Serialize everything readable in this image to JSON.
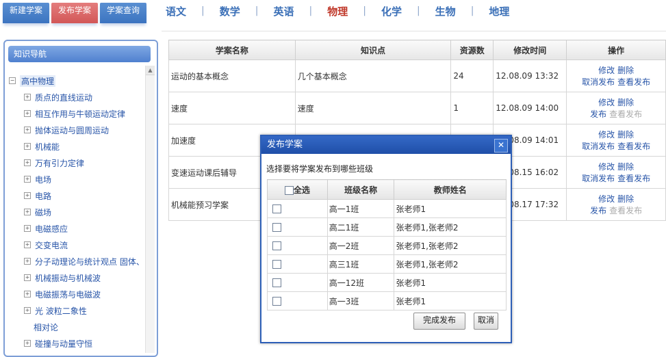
{
  "top_buttons": [
    "新建学案",
    "发布学案",
    "学案查询"
  ],
  "subjects": [
    "语文",
    "数学",
    "英语",
    "物理",
    "化学",
    "生物",
    "地理"
  ],
  "active_subject": "物理",
  "sidebar": {
    "title": "知识导航",
    "root": "高中物理",
    "items": [
      "质点的直线运动",
      "相互作用与牛顿运动定律",
      "抛体运动与圆周运动",
      "机械能",
      "万有引力定律",
      "电场",
      "电路",
      "磁场",
      "电磁感应",
      "交变电流",
      "分子动理论与统计观点 固体、液",
      "机械振动与机械波",
      "电磁振荡与电磁波",
      "光 波粒二象性",
      "相对论",
      "碰撞与动量守恒"
    ]
  },
  "table": {
    "headers": [
      "学案名称",
      "知识点",
      "资源数",
      "修改时间",
      "操作"
    ],
    "rows": [
      {
        "name": "运动的基本概念",
        "topic": "几个基本概念",
        "count": "24",
        "time": "12.08.09 13:32",
        "ops": [
          "修改",
          "删除",
          "取消发布",
          "查看发布"
        ]
      },
      {
        "name": "速度",
        "topic": "速度",
        "count": "1",
        "time": "12.08.09 14:00",
        "ops": [
          "修改",
          "删除",
          "发布",
          "查看发布"
        ]
      },
      {
        "name": "加速度",
        "topic": "",
        "count": "",
        "time": "12.08.09 14:01",
        "ops": [
          "修改",
          "删除",
          "取消发布",
          "查看发布"
        ]
      },
      {
        "name": "变速运动课后辅导",
        "topic": "",
        "count": "",
        "time": "12.08.15 16:02",
        "ops": [
          "修改",
          "删除",
          "取消发布",
          "查看发布"
        ]
      },
      {
        "name": "机械能预习学案",
        "topic": "",
        "count": "",
        "time": "12.08.17 17:32",
        "ops": [
          "修改",
          "删除",
          "发布",
          "查看发布"
        ]
      }
    ]
  },
  "dialog": {
    "title": "发布学案",
    "prompt": "选择要将学案发布到哪些班级",
    "headers": [
      "全选",
      "班级名称",
      "教师姓名"
    ],
    "rows": [
      {
        "class": "高一1班",
        "teacher": "张老师1"
      },
      {
        "class": "高二1班",
        "teacher": "张老师1,张老师2"
      },
      {
        "class": "高一2班",
        "teacher": "张老师1,张老师2"
      },
      {
        "class": "高三1班",
        "teacher": "张老师1,张老师2"
      },
      {
        "class": "高一12班",
        "teacher": "张老师1"
      },
      {
        "class": "高一3班",
        "teacher": "张老师1"
      }
    ],
    "confirm": "完成发布",
    "cancel": "取消"
  }
}
